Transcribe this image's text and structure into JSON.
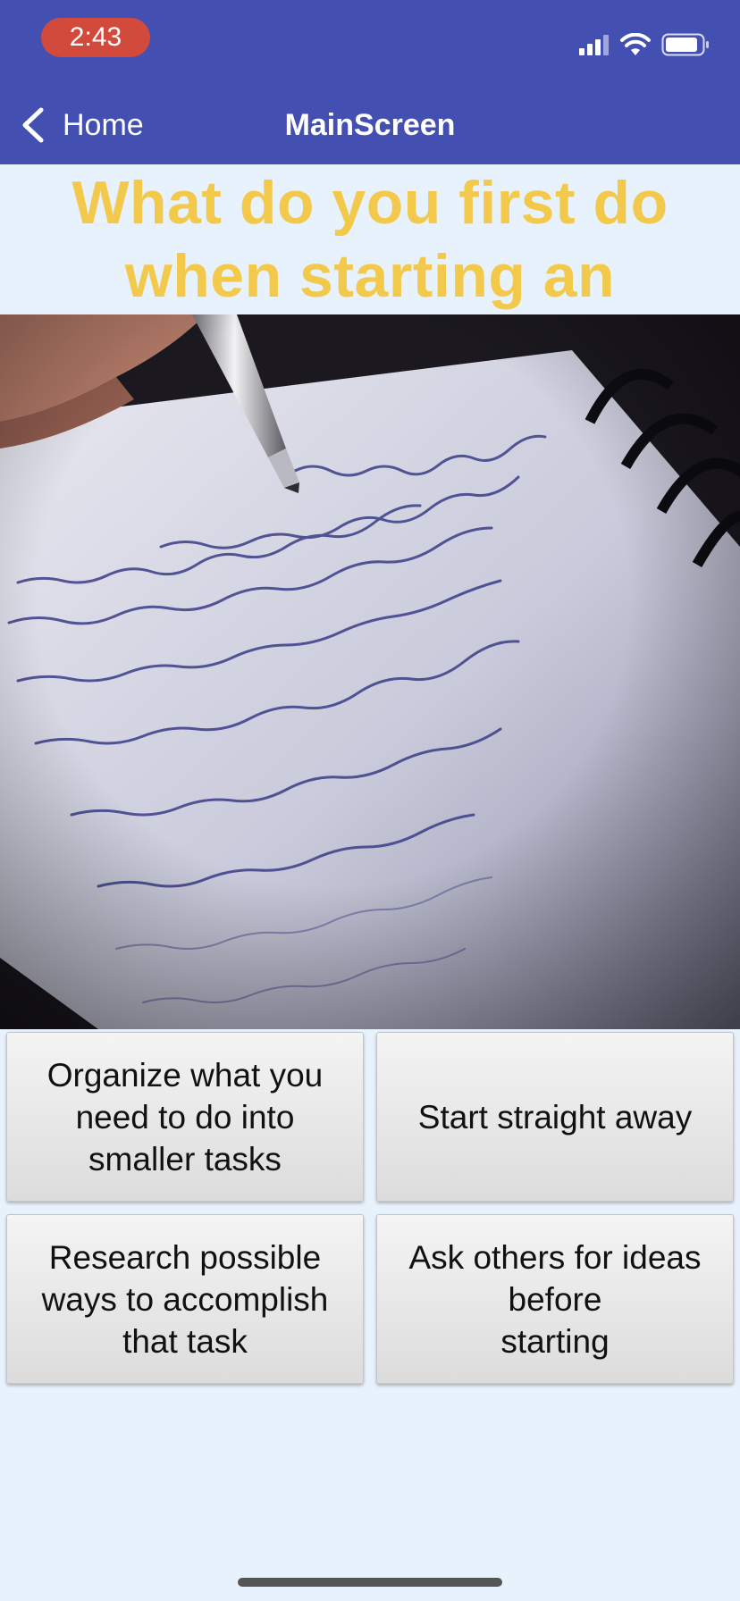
{
  "status_bar": {
    "time": "2:43"
  },
  "nav": {
    "back_label": "Home",
    "title": "MainScreen"
  },
  "question": {
    "text": "What do you first do when starting an assignment?"
  },
  "image": {
    "subject": "hand writing in a notebook with a pen"
  },
  "answers": [
    {
      "label": "Organize what you need to do into smaller tasks"
    },
    {
      "label": "Start straight away"
    },
    {
      "label": "Research possible ways to accomplish that task"
    },
    {
      "label": "Ask others for ideas before\nstarting"
    }
  ],
  "colors": {
    "nav_bar": "#4350b2",
    "time_pill": "#d24a3c",
    "question_text": "#f2c94a",
    "background": "#e8f2fc"
  }
}
